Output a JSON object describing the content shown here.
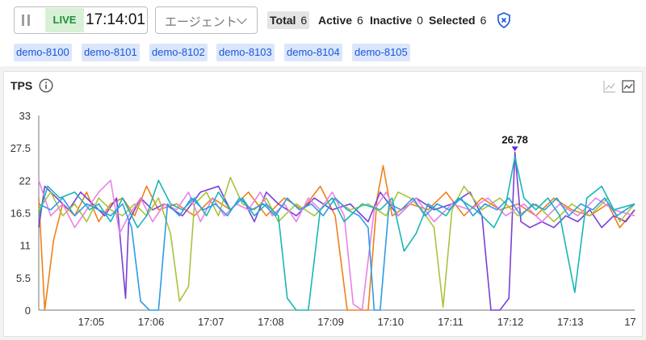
{
  "toolbar": {
    "live_label": "LIVE",
    "time": "17:14:01",
    "agent_select_placeholder": "エージェント",
    "stats": {
      "total_label": "Total",
      "total_value": "6",
      "active_label": "Active",
      "active_value": "6",
      "inactive_label": "Inactive",
      "inactive_value": "0",
      "selected_label": "Selected",
      "selected_value": "6"
    },
    "icons": {
      "pause": "pause-icon",
      "dropdown": "chevron-down-icon",
      "filter": "shield-filter-icon"
    }
  },
  "agents": [
    "demo-8100",
    "demo-8101",
    "demo-8102",
    "demo-8103",
    "demo-8104",
    "demo-8105"
  ],
  "colors": {
    "live_bg": "#d8f1d6",
    "live_text": "#1e8e3e",
    "tag_bg": "#dbe6fb",
    "tag_text": "#1a56db",
    "peak_marker": "#5b2bd6"
  },
  "panel": {
    "title": "TPS",
    "icons": [
      "info-icon",
      "line-chart-icon",
      "area-chart-icon"
    ]
  },
  "chart_data": {
    "type": "line",
    "title": "TPS",
    "xlabel": "",
    "ylabel": "",
    "x_range_minutes": [
      0,
      9.95
    ],
    "x_ticks": [
      "17:05",
      "17:06",
      "17:07",
      "17:08",
      "17:09",
      "17:10",
      "17:11",
      "17:12",
      "17:13",
      "17"
    ],
    "x_tick_positions": [
      0.875,
      1.875,
      2.875,
      3.875,
      4.875,
      5.875,
      6.875,
      7.875,
      8.875,
      9.875
    ],
    "ylim": [
      0,
      33
    ],
    "y_ticks": [
      "0",
      "5.5",
      "11",
      "16.5",
      "22",
      "27.5",
      "33"
    ],
    "y_tick_values": [
      0,
      5.5,
      11,
      16.5,
      22,
      27.5,
      33
    ],
    "grid": false,
    "peak_annotation": {
      "label": "26.78",
      "x": 7.95,
      "y": 26.78
    },
    "series": [
      {
        "color": "#f0801a",
        "points": [
          [
            0,
            19
          ],
          [
            0.1,
            0
          ],
          [
            0.25,
            12
          ],
          [
            0.4,
            18
          ],
          [
            0.6,
            16
          ],
          [
            0.8,
            20
          ],
          [
            1.0,
            15
          ],
          [
            1.2,
            18
          ],
          [
            1.4,
            19
          ],
          [
            1.6,
            16
          ],
          [
            1.8,
            21
          ],
          [
            2.0,
            17
          ],
          [
            2.3,
            18
          ],
          [
            2.6,
            16
          ],
          [
            2.9,
            19
          ],
          [
            3.2,
            17
          ],
          [
            3.5,
            20
          ],
          [
            3.8,
            16
          ],
          [
            4.1,
            19
          ],
          [
            4.4,
            17
          ],
          [
            4.7,
            21
          ],
          [
            4.95,
            16
          ],
          [
            5.15,
            0
          ],
          [
            5.3,
            0
          ],
          [
            5.5,
            0
          ],
          [
            5.65,
            19
          ],
          [
            5.75,
            24.5
          ],
          [
            5.9,
            16
          ],
          [
            6.2,
            18
          ],
          [
            6.5,
            17
          ],
          [
            6.8,
            20
          ],
          [
            7.1,
            16
          ],
          [
            7.4,
            19
          ],
          [
            7.7,
            17
          ],
          [
            8.0,
            18
          ],
          [
            8.3,
            16
          ],
          [
            8.6,
            19
          ],
          [
            8.9,
            17
          ],
          [
            9.2,
            16
          ],
          [
            9.5,
            18
          ],
          [
            9.7,
            14
          ],
          [
            9.95,
            17
          ]
        ]
      },
      {
        "color": "#7a3fd8",
        "points": [
          [
            0,
            14
          ],
          [
            0.1,
            21
          ],
          [
            0.3,
            19
          ],
          [
            0.5,
            17
          ],
          [
            0.7,
            20
          ],
          [
            0.9,
            18
          ],
          [
            1.1,
            16
          ],
          [
            1.3,
            19
          ],
          [
            1.45,
            2
          ],
          [
            1.5,
            15
          ],
          [
            1.7,
            19
          ],
          [
            1.9,
            17
          ],
          [
            2.1,
            18
          ],
          [
            2.4,
            16
          ],
          [
            2.7,
            20
          ],
          [
            3.0,
            21
          ],
          [
            3.2,
            17
          ],
          [
            3.4,
            19
          ],
          [
            3.6,
            15
          ],
          [
            3.8,
            20
          ],
          [
            4.0,
            18
          ],
          [
            4.3,
            16
          ],
          [
            4.6,
            19
          ],
          [
            4.9,
            17
          ],
          [
            5.2,
            18
          ],
          [
            5.5,
            15
          ],
          [
            5.7,
            20
          ],
          [
            6.0,
            16
          ],
          [
            6.3,
            19
          ],
          [
            6.6,
            17
          ],
          [
            6.9,
            18
          ],
          [
            7.2,
            20
          ],
          [
            7.4,
            16
          ],
          [
            7.55,
            0
          ],
          [
            7.7,
            0
          ],
          [
            7.85,
            2
          ],
          [
            7.95,
            26.78
          ],
          [
            8.05,
            15
          ],
          [
            8.2,
            14
          ],
          [
            8.4,
            15
          ],
          [
            8.6,
            14
          ],
          [
            8.8,
            16
          ],
          [
            9.0,
            15
          ],
          [
            9.2,
            17
          ],
          [
            9.4,
            14
          ],
          [
            9.6,
            16
          ],
          [
            9.8,
            15
          ],
          [
            9.95,
            17
          ]
        ]
      },
      {
        "color": "#a8c43c",
        "points": [
          [
            0,
            17
          ],
          [
            0.2,
            20
          ],
          [
            0.4,
            16
          ],
          [
            0.6,
            18
          ],
          [
            0.8,
            15
          ],
          [
            1.0,
            19
          ],
          [
            1.2,
            17
          ],
          [
            1.4,
            16
          ],
          [
            1.6,
            18
          ],
          [
            1.8,
            16
          ],
          [
            2.0,
            19
          ],
          [
            2.2,
            13
          ],
          [
            2.35,
            1.5
          ],
          [
            2.5,
            4
          ],
          [
            2.6,
            18
          ],
          [
            2.8,
            20
          ],
          [
            3.0,
            16
          ],
          [
            3.2,
            22.5
          ],
          [
            3.4,
            18
          ],
          [
            3.6,
            17
          ],
          [
            3.8,
            19
          ],
          [
            4.0,
            15
          ],
          [
            4.3,
            18
          ],
          [
            4.6,
            16
          ],
          [
            4.9,
            19
          ],
          [
            5.2,
            17
          ],
          [
            5.5,
            18
          ],
          [
            5.8,
            16
          ],
          [
            6.0,
            20
          ],
          [
            6.2,
            19
          ],
          [
            6.4,
            17
          ],
          [
            6.6,
            14
          ],
          [
            6.75,
            0.5
          ],
          [
            6.9,
            17
          ],
          [
            7.1,
            21
          ],
          [
            7.4,
            17
          ],
          [
            7.7,
            19
          ],
          [
            8.0,
            16
          ],
          [
            8.3,
            18
          ],
          [
            8.6,
            15
          ],
          [
            8.9,
            18
          ],
          [
            9.2,
            16
          ],
          [
            9.5,
            19
          ],
          [
            9.7,
            15
          ],
          [
            9.95,
            18
          ]
        ]
      },
      {
        "color": "#e882e6",
        "points": [
          [
            0,
            22
          ],
          [
            0.2,
            16
          ],
          [
            0.4,
            18
          ],
          [
            0.6,
            14
          ],
          [
            0.8,
            17
          ],
          [
            1.0,
            20
          ],
          [
            1.2,
            22
          ],
          [
            1.35,
            13
          ],
          [
            1.5,
            16
          ],
          [
            1.7,
            19
          ],
          [
            1.9,
            15
          ],
          [
            2.1,
            18
          ],
          [
            2.3,
            17
          ],
          [
            2.5,
            20
          ],
          [
            2.7,
            15
          ],
          [
            2.9,
            19
          ],
          [
            3.1,
            16
          ],
          [
            3.3,
            18
          ],
          [
            3.5,
            17
          ],
          [
            3.7,
            20
          ],
          [
            3.9,
            16
          ],
          [
            4.1,
            18
          ],
          [
            4.3,
            15
          ],
          [
            4.5,
            19
          ],
          [
            4.7,
            17
          ],
          [
            4.9,
            20
          ],
          [
            5.1,
            16
          ],
          [
            5.25,
            1
          ],
          [
            5.4,
            0
          ],
          [
            5.6,
            17
          ],
          [
            5.8,
            20
          ],
          [
            6.0,
            16
          ],
          [
            6.3,
            19
          ],
          [
            6.6,
            15
          ],
          [
            6.9,
            18
          ],
          [
            7.2,
            17
          ],
          [
            7.5,
            19
          ],
          [
            7.8,
            16
          ],
          [
            8.1,
            18
          ],
          [
            8.4,
            15
          ],
          [
            8.7,
            18
          ],
          [
            9.0,
            16
          ],
          [
            9.3,
            19
          ],
          [
            9.6,
            17
          ],
          [
            9.95,
            16
          ]
        ]
      },
      {
        "color": "#16b7b4",
        "points": [
          [
            0,
            16
          ],
          [
            0.15,
            21
          ],
          [
            0.35,
            19
          ],
          [
            0.6,
            20
          ],
          [
            0.85,
            17
          ],
          [
            1.0,
            18
          ],
          [
            1.2,
            15
          ],
          [
            1.4,
            19
          ],
          [
            1.5,
            17
          ],
          [
            1.65,
            14
          ],
          [
            1.8,
            16
          ],
          [
            2.0,
            22
          ],
          [
            2.2,
            18
          ],
          [
            2.4,
            17
          ],
          [
            2.6,
            19
          ],
          [
            2.8,
            16
          ],
          [
            3.0,
            20
          ],
          [
            3.2,
            17
          ],
          [
            3.4,
            19
          ],
          [
            3.6,
            16
          ],
          [
            3.8,
            18
          ],
          [
            4.0,
            16
          ],
          [
            4.15,
            2
          ],
          [
            4.3,
            0
          ],
          [
            4.5,
            0
          ],
          [
            4.7,
            17
          ],
          [
            4.9,
            19
          ],
          [
            5.1,
            15
          ],
          [
            5.4,
            18
          ],
          [
            5.7,
            17
          ],
          [
            5.9,
            19
          ],
          [
            6.1,
            10
          ],
          [
            6.3,
            13
          ],
          [
            6.5,
            18
          ],
          [
            6.8,
            16
          ],
          [
            7.0,
            19
          ],
          [
            7.3,
            17
          ],
          [
            7.6,
            14
          ],
          [
            7.8,
            18
          ],
          [
            7.95,
            26
          ],
          [
            8.1,
            19
          ],
          [
            8.3,
            17
          ],
          [
            8.5,
            19
          ],
          [
            8.7,
            16
          ],
          [
            8.95,
            3
          ],
          [
            9.15,
            19
          ],
          [
            9.4,
            21
          ],
          [
            9.6,
            17
          ],
          [
            9.95,
            18
          ]
        ]
      },
      {
        "color": "#2f9be6",
        "points": [
          [
            0,
            18
          ],
          [
            0.2,
            17
          ],
          [
            0.4,
            19
          ],
          [
            0.6,
            16
          ],
          [
            0.8,
            18
          ],
          [
            1.0,
            17
          ],
          [
            1.2,
            16
          ],
          [
            1.4,
            18
          ],
          [
            1.55,
            14
          ],
          [
            1.7,
            1.5
          ],
          [
            1.85,
            0
          ],
          [
            2.0,
            0
          ],
          [
            2.15,
            18
          ],
          [
            2.35,
            16
          ],
          [
            2.55,
            19
          ],
          [
            2.75,
            17
          ],
          [
            2.95,
            18
          ],
          [
            3.15,
            16
          ],
          [
            3.35,
            19
          ],
          [
            3.55,
            17
          ],
          [
            3.75,
            18
          ],
          [
            3.95,
            16
          ],
          [
            4.15,
            19
          ],
          [
            4.35,
            17
          ],
          [
            4.55,
            18
          ],
          [
            4.75,
            16
          ],
          [
            4.95,
            19
          ],
          [
            5.15,
            17
          ],
          [
            5.35,
            16
          ],
          [
            5.5,
            14
          ],
          [
            5.6,
            0
          ],
          [
            5.7,
            0
          ],
          [
            5.85,
            18
          ],
          [
            6.05,
            17
          ],
          [
            6.25,
            19
          ],
          [
            6.45,
            16
          ],
          [
            6.65,
            18
          ],
          [
            6.85,
            17
          ],
          [
            7.05,
            19
          ],
          [
            7.25,
            16
          ],
          [
            7.45,
            18
          ],
          [
            7.65,
            17
          ],
          [
            7.85,
            19
          ],
          [
            8.05,
            16
          ],
          [
            8.25,
            18
          ],
          [
            8.45,
            17
          ],
          [
            8.65,
            19
          ],
          [
            8.85,
            16
          ],
          [
            9.05,
            18
          ],
          [
            9.25,
            17
          ],
          [
            9.45,
            19
          ],
          [
            9.65,
            16
          ],
          [
            9.95,
            18
          ]
        ]
      }
    ]
  }
}
